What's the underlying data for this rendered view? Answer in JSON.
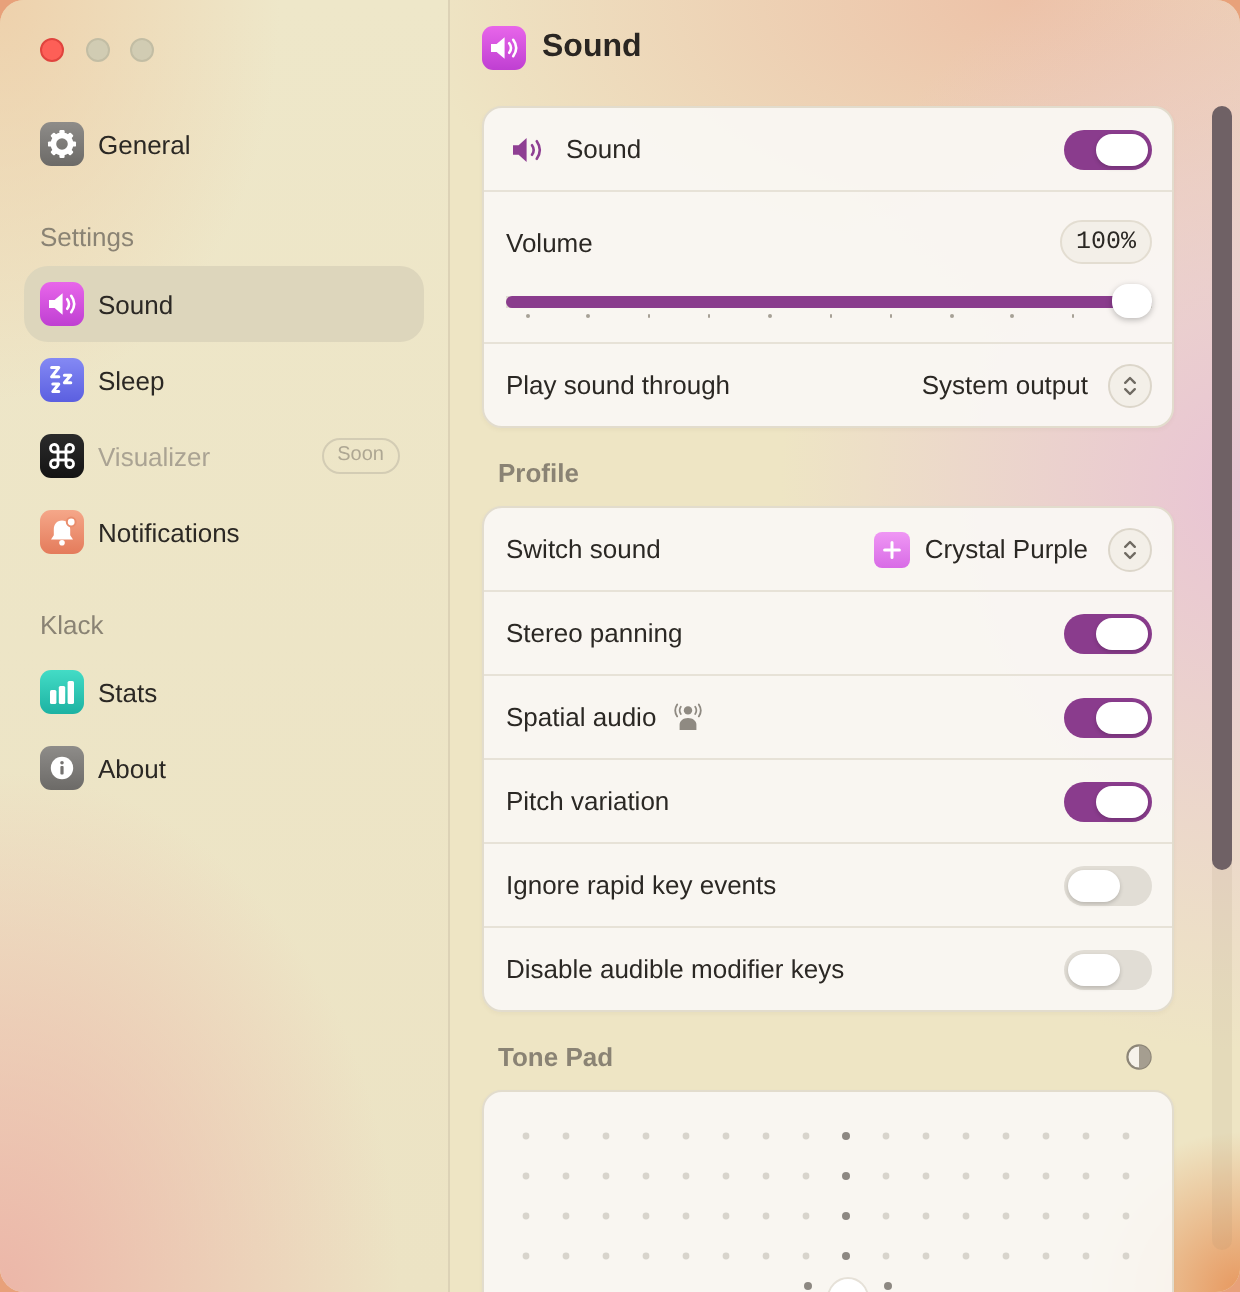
{
  "sidebar": {
    "groups": [
      {
        "items": [
          {
            "label": "General",
            "selected": false,
            "disabled": false
          }
        ]
      },
      {
        "heading": "Settings",
        "items": [
          {
            "label": "Sound",
            "selected": true,
            "disabled": false
          },
          {
            "label": "Sleep",
            "selected": false,
            "disabled": false
          },
          {
            "label": "Visualizer",
            "selected": false,
            "disabled": true,
            "badge": "Soon"
          },
          {
            "label": "Notifications",
            "selected": false,
            "disabled": false
          }
        ]
      },
      {
        "heading": "Klack",
        "items": [
          {
            "label": "Stats",
            "selected": false,
            "disabled": false
          },
          {
            "label": "About",
            "selected": false,
            "disabled": false
          }
        ]
      }
    ]
  },
  "header": {
    "title": "Sound"
  },
  "sections": [
    {
      "kind": "list",
      "rows": [
        {
          "kind": "toggle",
          "label": "Sound",
          "on": true
        },
        {
          "kind": "slider",
          "label": "Volume",
          "reading": "100%",
          "level": 1
        },
        {
          "kind": "select",
          "label": "Play sound through",
          "value": "System output"
        }
      ]
    },
    {
      "kind": "list",
      "heading": "Profile",
      "rows": [
        {
          "kind": "select",
          "label": "Switch sound",
          "value": "Crystal Purple"
        },
        {
          "kind": "toggle",
          "label": "Stereo panning",
          "on": true
        },
        {
          "kind": "toggle",
          "label": "Spatial audio",
          "on": true
        },
        {
          "kind": "toggle",
          "label": "Pitch variation",
          "on": true
        },
        {
          "kind": "toggle",
          "label": "Ignore rapid key events",
          "on": false
        },
        {
          "kind": "toggle",
          "label": "Disable audible modifier keys",
          "on": false
        }
      ]
    },
    {
      "kind": "pad",
      "heading": "Tone Pad"
    }
  ]
}
